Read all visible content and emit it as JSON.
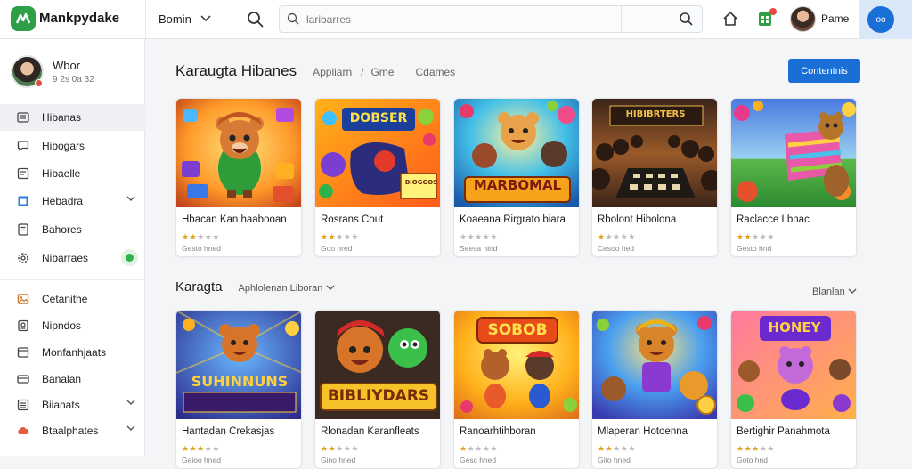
{
  "app": {
    "logo_text": "Mankpydake"
  },
  "topbar": {
    "menu_label": "Bomin",
    "search_placeholder": "laribarres",
    "user_name": "Pame",
    "account_initials": "oo"
  },
  "sidebar": {
    "profile": {
      "name": "Wbor",
      "subtitle": "9 2s 0a 32"
    },
    "items": [
      {
        "label": "Hibanas",
        "icon": "grid-icon",
        "active": true
      },
      {
        "label": "Hibogars",
        "icon": "chat-icon"
      },
      {
        "label": "Hibaelle",
        "icon": "document-icon"
      },
      {
        "label": "Hebadra",
        "icon": "window-icon",
        "chevron": true
      },
      {
        "label": "Bahores",
        "icon": "page-icon"
      },
      {
        "label": "Nibarraes",
        "icon": "gear-icon",
        "dot": true
      },
      {
        "label": "Cetanithe",
        "icon": "image-icon"
      },
      {
        "label": "Nipndos",
        "icon": "badge-icon"
      },
      {
        "label": "Monfanhjaats",
        "icon": "folder-icon"
      },
      {
        "label": "Banalan",
        "icon": "card-icon"
      },
      {
        "label": "Biianats",
        "icon": "list-icon",
        "chevron": true
      },
      {
        "label": "Btaalphates",
        "icon": "cloud-icon",
        "chevron": true
      }
    ]
  },
  "main": {
    "title": "Karaugta Hibanes",
    "breadcrumb": [
      "Appliarn",
      "/",
      "Gme",
      "Cdames"
    ],
    "primary_button": "Contentnis",
    "section2_title": "Karagta",
    "section2_filter": "Aphlolenan Liboran",
    "sort_label": "Blanlan"
  },
  "cards_row1": [
    {
      "title": "Hbacan Kan haabooan",
      "stars": 2,
      "meta": "Gesto hned"
    },
    {
      "title": "Rosrans Cout",
      "stars": 2,
      "meta": "Goo hred"
    },
    {
      "title": "Koaeana Rirgrato biara",
      "stars": 0,
      "meta": "Seesa hind"
    },
    {
      "title": "Rbolont Hibolona",
      "stars": 1,
      "meta": "Cesoo hed"
    },
    {
      "title": "Raclacce Lbnac",
      "stars": 2,
      "meta": "Gesto hnd"
    }
  ],
  "cards_row2": [
    {
      "title": "Hantadan Crekasjas",
      "stars": 3,
      "meta": "Geioo hned"
    },
    {
      "title": "Rlonadan Karanfleats",
      "stars": 2,
      "meta": "Gino hned"
    },
    {
      "title": "Ranoarhtihboran",
      "stars": 1,
      "meta": "Gesc hned"
    },
    {
      "title": "Mlaperan Hotoenna",
      "stars": 2,
      "meta": "Gito hned"
    },
    {
      "title": "Bertighir Panahmota",
      "stars": 3,
      "meta": "Goto hnd"
    }
  ],
  "art_labels": {
    "r1c2": "DOBSER",
    "r1c2b": "BIOGGOS",
    "r1c3": "MARBOMAL",
    "r1c4": "HIBIBRTERS",
    "r2c1": "SUHINNUNS",
    "r2c2": "BIBLIYDARS",
    "r2c3": "SOBOB",
    "r2c5": "HONEY"
  },
  "colors": {
    "accent": "#1a6fd6",
    "brand": "#2e9e47",
    "star": "#e2a51f"
  }
}
